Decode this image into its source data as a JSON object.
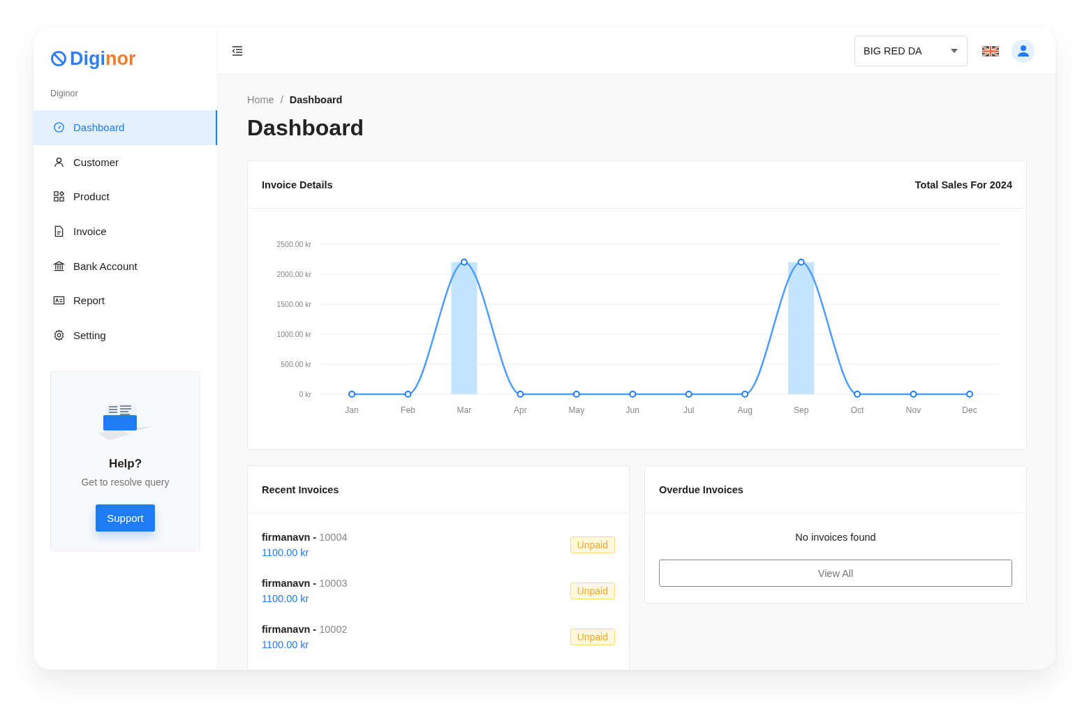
{
  "brand": {
    "part_1": "Digi",
    "part_2": "nor"
  },
  "sidebar": {
    "section_label": "Diginor",
    "items": [
      {
        "label": "Dashboard",
        "kind": "dashboard",
        "selected": true
      },
      {
        "label": "Customer",
        "kind": "customer",
        "selected": false
      },
      {
        "label": "Product",
        "kind": "product",
        "selected": false
      },
      {
        "label": "Invoice",
        "kind": "invoice",
        "selected": false
      },
      {
        "label": "Bank Account",
        "kind": "bank",
        "selected": false
      },
      {
        "label": "Report",
        "kind": "report",
        "selected": false
      },
      {
        "label": "Setting",
        "kind": "setting",
        "selected": false
      }
    ],
    "help": {
      "title": "Help?",
      "text": "Get to resolve query",
      "button": "Support"
    }
  },
  "header": {
    "company_select": {
      "value": "BIG RED DA"
    }
  },
  "breadcrumb": {
    "separator": "/",
    "items": [
      {
        "label": "Home",
        "selected": false
      },
      {
        "label": "Dashboard",
        "selected": true
      }
    ]
  },
  "page_title": "Dashboard",
  "invoice_details": {
    "title": "Invoice Details",
    "subtitle": "Total Sales For 2024",
    "chart_data": {
      "type": "bar",
      "categories": [
        "Jan",
        "Feb",
        "Mar",
        "Apr",
        "May",
        "Jun",
        "Jul",
        "Aug",
        "Sep",
        "Oct",
        "Nov",
        "Dec"
      ],
      "series": [
        {
          "color": "#c4e3fd",
          "values": [
            0,
            0,
            2200,
            0,
            0,
            0,
            0,
            0,
            2200,
            0,
            0,
            0
          ]
        },
        {
          "type": "line",
          "marker": "circle",
          "color": "#4d9cff",
          "values": [
            0,
            0,
            2200,
            0,
            0,
            0,
            0,
            0,
            2200,
            0,
            0,
            0
          ]
        }
      ],
      "ylim": [
        0,
        2500
      ],
      "grid": true,
      "yticks": [
        {
          "value": 0,
          "label": "0 kr"
        },
        {
          "value": 500,
          "label": "500.00 kr"
        },
        {
          "value": 1000,
          "label": "1000.00 kr"
        },
        {
          "value": 1500,
          "label": "1500.00 kr"
        },
        {
          "value": 2000,
          "label": "2000.00 kr"
        },
        {
          "value": 2500,
          "label": "2500.00 kr"
        }
      ]
    }
  },
  "recent_invoices": {
    "title": "Recent Invoices",
    "items": [
      {
        "customer": "firmanavn",
        "separator": "-",
        "number": "10004",
        "amount": "1100.00 kr",
        "status": "Unpaid"
      },
      {
        "customer": "firmanavn",
        "separator": "-",
        "number": "10003",
        "amount": "1100.00 kr",
        "status": "Unpaid"
      },
      {
        "customer": "firmanavn",
        "separator": "-",
        "number": "10002",
        "amount": "1100.00 kr",
        "status": "Unpaid"
      }
    ]
  },
  "overdue_invoices": {
    "title": "Overdue Invoices",
    "empty_text": "No invoices found",
    "button": "View All"
  }
}
